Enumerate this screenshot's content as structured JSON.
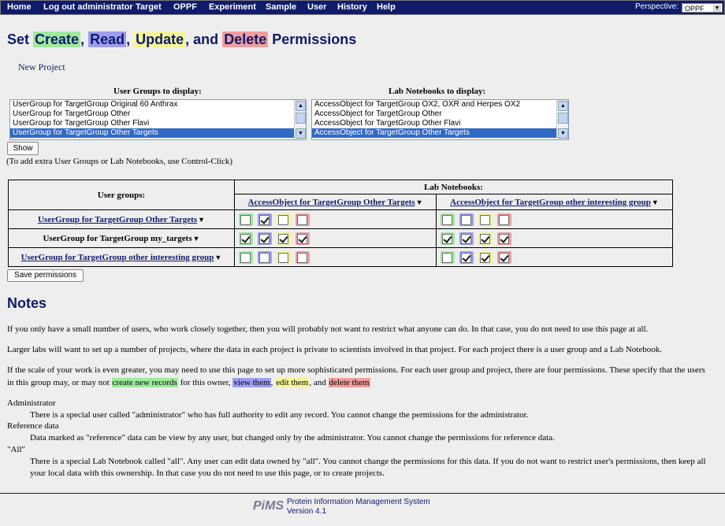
{
  "nav": {
    "items": [
      "Home",
      "Log out administrator",
      "Target",
      "OPPF",
      "Experiment",
      "Sample",
      "User",
      "History",
      "Help"
    ],
    "perspective_label": "Perspective:",
    "perspective_value": "OPPF"
  },
  "page": {
    "title_prefix": "Set",
    "title_create": "Create",
    "title_comma1": ",",
    "title_read": "Read",
    "title_comma2": ",",
    "title_update": "Update",
    "title_and": ", and",
    "title_delete": "Delete",
    "title_suffix": "Permissions",
    "new_project_link": "New Project"
  },
  "selectors": {
    "user_groups_label": "User Groups to display:",
    "user_groups": [
      "UserGroup for TargetGroup Original 60 Anthrax",
      "UserGroup for TargetGroup Other",
      "UserGroup for TargetGroup Other Flavi",
      "UserGroup for TargetGroup Other Targets"
    ],
    "notebooks_label": "Lab Notebooks to display:",
    "notebooks": [
      "AccessObject for TargetGroup OX2, OXR and Herpes OX2",
      "AccessObject for TargetGroup Other",
      "AccessObject for TargetGroup Other Flavi",
      "AccessObject for TargetGroup Other Targets"
    ],
    "show_button": "Show",
    "hint": "(To add extra User Groups or Lab Notebooks, use Control-Click)"
  },
  "permissions": {
    "user_groups_header": "User groups:",
    "lab_notebooks_header": "Lab Notebooks:",
    "notebook_cols": [
      "AccessObject for TargetGroup Other Targets",
      "AccessObject for TargetGroup other interesting group"
    ],
    "rows": [
      {
        "name": "UserGroup for TargetGroup Other Targets",
        "cells": [
          [
            false,
            true,
            false,
            false
          ],
          [
            false,
            false,
            false,
            false
          ]
        ]
      },
      {
        "name": "UserGroup for TargetGroup my_targets",
        "cells": [
          [
            true,
            true,
            true,
            true
          ],
          [
            true,
            true,
            true,
            true
          ]
        ]
      },
      {
        "name": "UserGroup for TargetGroup other interesting group",
        "cells": [
          [
            false,
            false,
            false,
            false
          ],
          [
            false,
            true,
            true,
            true
          ]
        ]
      }
    ],
    "save_button": "Save permissions"
  },
  "notes": {
    "title": "Notes",
    "p1": "If you only have a small number of users, who work closely together, then you will probably not want to restrict what anyone can do. In that case, you do not need to use this page at all.",
    "p2": "Larger labs will want to set up a number of projects, where the data in each project is private to scientists involved in that project. For each project there is a user group and a Lab Notebook.",
    "p3a": "If the scale of your work is even greater, you may need to use this page to set up more sophisticated permissions. For each user group and project, there are four permissions. These specify that the users",
    "p3b": "in this group may, or may not",
    "p3_create": "create new records",
    "p3c": "for this owner,",
    "p3_view": "view them",
    "p3d": ",",
    "p3_edit": "edit them",
    "p3e": ", and",
    "p3_delete": "delete them",
    "admin_term": "Administrator",
    "admin_desc": "There is a special user called \"administrator\" who has full authority to edit any record. You cannot change the permissions for the administrator.",
    "ref_term": "Reference data",
    "ref_desc": "Data marked as \"reference\" data can be view by any user, but changed only by the administrator. You cannot change the permissions for reference data.",
    "all_term": "\"All\"",
    "all_desc1": "There is a special Lab Notebook called \"all\". Any user can edit data owned by \"all\". You cannot change the permissions for this data. If you do not want to restrict user's permissions, then keep all",
    "all_desc2": "your local data with this ownership. In that case you do not need to use this page, or to create projects."
  },
  "footer": {
    "logo": "PiMS",
    "line1": "Protein Information Management System",
    "line2": "Version 4.1"
  },
  "colors": {
    "create": "#9dea9d",
    "read": "#9d9df0",
    "update": "#f5f59a",
    "delete": "#f09d9d",
    "nav_bg": "#0f1b6b"
  }
}
